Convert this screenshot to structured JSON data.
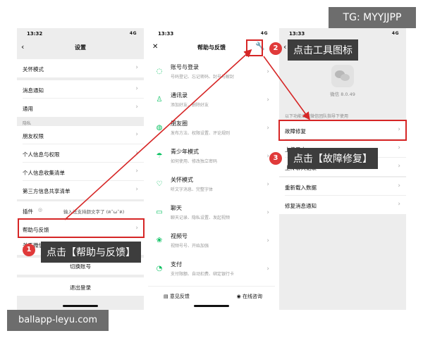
{
  "watermark_top": "TG: MYYJJPP",
  "watermark_bottom": "ballapp-leyu.com",
  "screen1": {
    "time": "13:32",
    "signal": "4G",
    "title": "设置",
    "rows": [
      {
        "label": "关怀模式"
      },
      {
        "label": "消息通知"
      },
      {
        "label": "通用"
      },
      {
        "label": "朋友权限"
      },
      {
        "label": "个人信息与权限"
      },
      {
        "label": "个人信息收集清单"
      },
      {
        "label": "第三方信息共享清单"
      }
    ],
    "privacy_section": "隐私",
    "plugin_label": "插件",
    "plugin_hint": "输入法支持颜文字了 (ฅ˘ω˘ฅ)",
    "help_row": "帮助与反馈",
    "about_row": "关于微信",
    "switch_account": "切换账号",
    "logout": "退出登录"
  },
  "screen2": {
    "time": "13:33",
    "signal": "4G",
    "title": "帮助与反馈",
    "items": [
      {
        "title": "账号与登录",
        "sub": "号码登记、忘记密码、封号与解封"
      },
      {
        "title": "通讯录",
        "sub": "添加好友、删除好友"
      },
      {
        "title": "朋友圈",
        "sub": "发布方法、权限设置、评论规则"
      },
      {
        "title": "青少年模式",
        "sub": "如何使用、修改独立密码"
      },
      {
        "title": "关怀模式",
        "sub": "听文字消息、完整字体"
      },
      {
        "title": "聊天",
        "sub": "聊天记录、隐私设置、发起视频"
      },
      {
        "title": "视频号",
        "sub": "视频号号、开始加强"
      },
      {
        "title": "支付",
        "sub": "支付限额、自动扣费、绑定银行卡"
      }
    ],
    "feedback_btn": "意见反馈",
    "online_btn": "在线咨询"
  },
  "screen3": {
    "time": "13:33",
    "signal": "4G",
    "version": "微信 8.0.49",
    "hint": "以下功能请在微信团队指导下使用",
    "fault_repair": "故障修复",
    "upload_log": "上传日志",
    "upload_record": "上传聊天记录",
    "reload_data": "重新载入数据",
    "repair_notice": "修复消息通知"
  },
  "annotations": {
    "step1_num": "1",
    "step1_text": "点击【帮助与反馈】",
    "step2_num": "2",
    "step2_text": "点击工具图标",
    "step3_num": "3",
    "step3_text": "点击【故障修复】"
  },
  "colors": {
    "annotation_red": "#d62626",
    "wechat_green": "#07c160",
    "callout_bg": "#3d3d3d"
  }
}
